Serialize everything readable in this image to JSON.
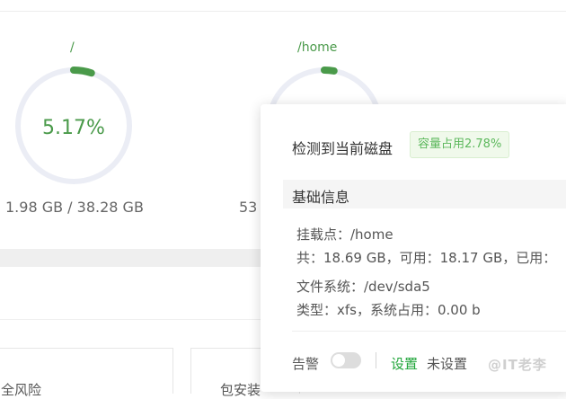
{
  "disks": [
    {
      "mount": "/",
      "percent_label": "5.17%",
      "percent": 5.17,
      "usage_label": "1.98 GB / 38.28 GB"
    },
    {
      "mount": "/home",
      "percent": 2.78,
      "usage_label_partial": "53"
    }
  ],
  "cards": [
    {
      "label_partial": "全风险"
    },
    {
      "label_partial": "包安装"
    }
  ],
  "popover": {
    "title": "检测到当前磁盘",
    "badge": "容量占用2.78%",
    "section_title": "基础信息",
    "mount_line": "挂载点：/home",
    "capacity_line": "共：18.69 GB，可用：18.17 GB，已用：",
    "fs_line": "文件系统：/dev/sda5",
    "type_line": "类型：xfs，系统占用：0.00 b",
    "alert_label": "告警",
    "alert_enabled": false,
    "settings_link": "设置",
    "settings_status": "未设置",
    "watermark": "@IT老李"
  },
  "colors": {
    "accent": "#20a53a",
    "ring_progress": "#4a9a4a",
    "ring_track": "#ebedf5",
    "badge_bg": "#f0f9eb",
    "section_bg": "#f5f5f5"
  }
}
